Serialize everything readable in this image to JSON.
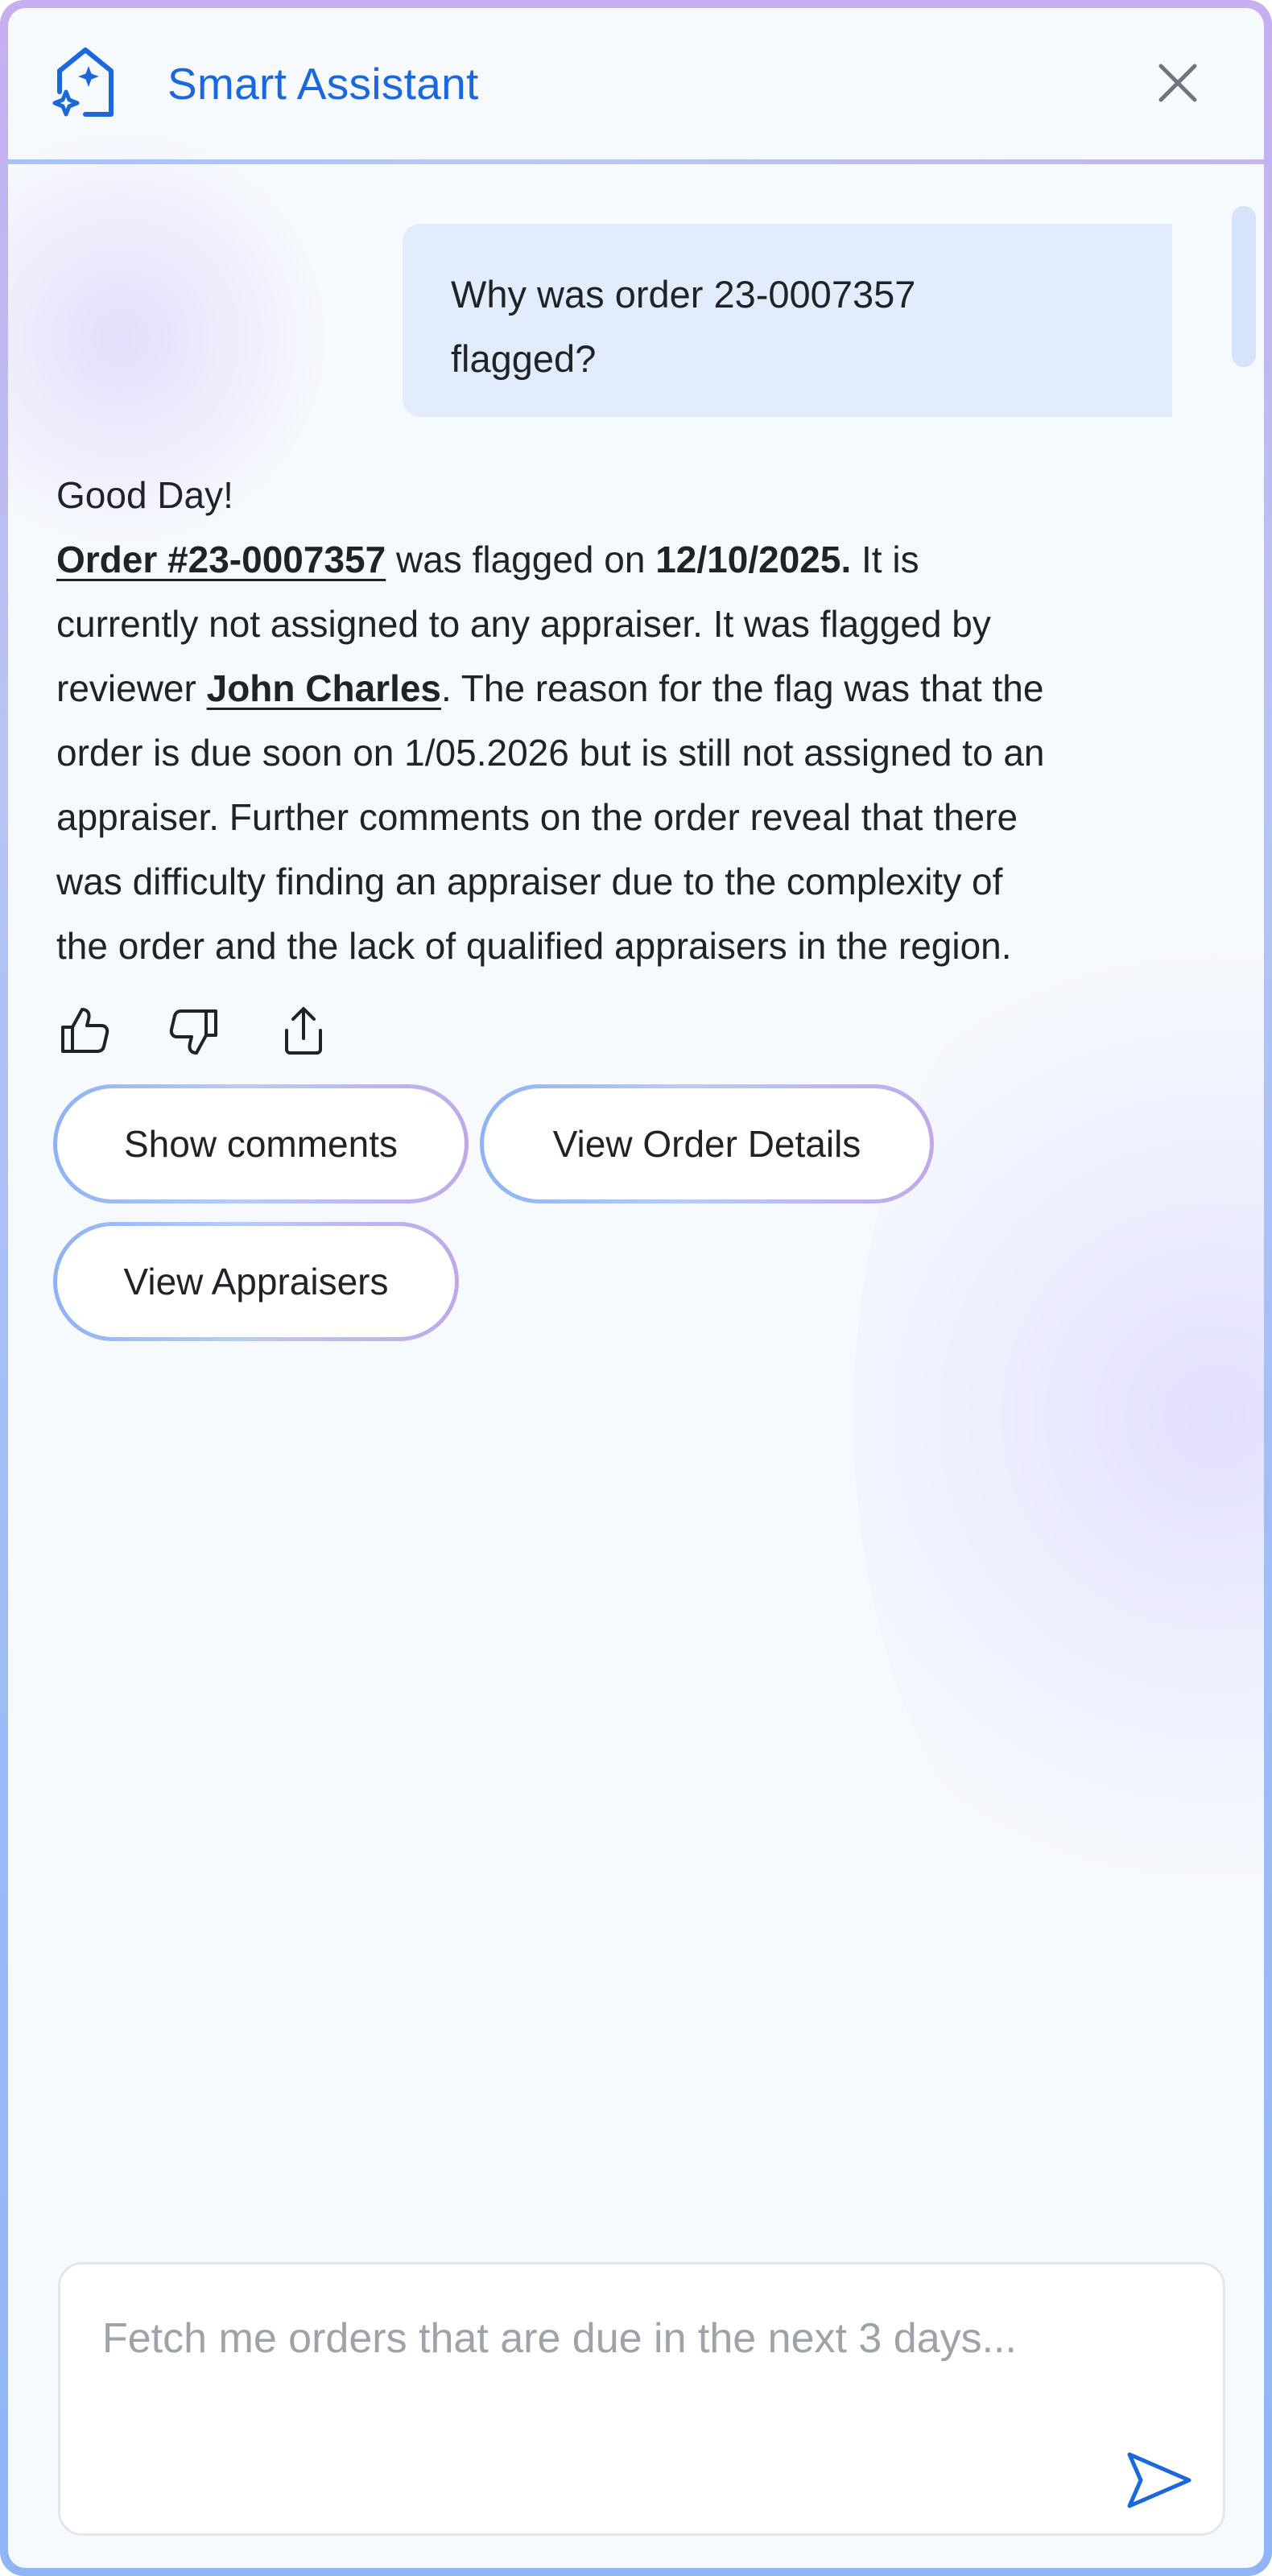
{
  "header": {
    "title": "Smart Assistant",
    "logo_icon": "home-sparkle-icon",
    "close_icon": "close-icon",
    "accent_color": "#1a68dc"
  },
  "conversation": {
    "user_message": {
      "line1": "Why was order 23-0007357",
      "line2": "flagged?"
    },
    "assistant_message": {
      "greeting": "Good Day!",
      "order_link": "Order #23-0007357",
      "t1": " was flagged on ",
      "flag_date": "12/10/2025.",
      "t2": " It is",
      "line3": "currently not assigned to any appraiser. It was flagged by",
      "t3": "reviewer ",
      "reviewer_link": "John Charles",
      "t4": ". The reason for the flag was that the",
      "line5": "order is due soon on 1/05.2026 but is still not assigned to an",
      "line6": "appraiser. Further comments on the order reveal that there",
      "line7": "was difficulty finding an appraiser due to the complexity of",
      "line8": "the order and the lack of qualified appraisers in the region."
    },
    "feedback_icons": [
      "thumbs-up-icon",
      "thumbs-down-icon",
      "share-icon"
    ]
  },
  "suggestions": {
    "show_comments": "Show comments",
    "view_order_details": "View Order Details",
    "view_appraisers": "View Appraisers"
  },
  "composer": {
    "placeholder": "Fetch me orders that are due in the next 3 days...",
    "value": "",
    "send_icon": "send-icon"
  }
}
